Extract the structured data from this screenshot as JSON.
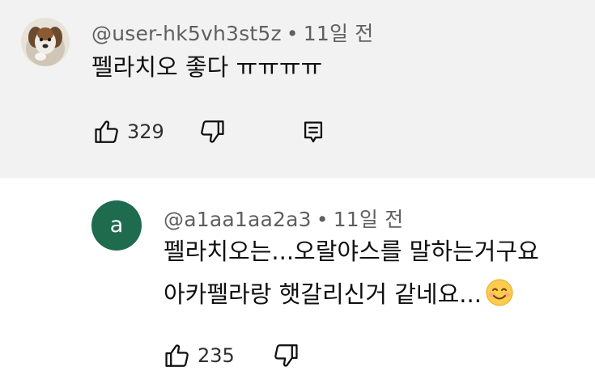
{
  "comment": {
    "author": "@user-hk5vh3st5z",
    "separator": "•",
    "time": "11일 전",
    "text": "펠라치오 좋다 ㅠㅠㅠㅠ",
    "like_count": "329"
  },
  "reply": {
    "avatar_letter": "a",
    "author": "@a1aa1aa2a3",
    "separator": "•",
    "time": "11일 전",
    "line1": "펠라치오는...오랄야스를 말하는거구요",
    "line2": "아카펠라랑 햇갈리신거 같네요...",
    "like_count": "235"
  },
  "colors": {
    "top_background": "#f2f2f2",
    "avatar_green": "#1e6b4d",
    "meta_gray": "#606060"
  },
  "icons": {
    "like": "thumbs-up-icon",
    "dislike": "thumbs-down-icon",
    "reply": "reply-comment-icon",
    "emoji": "smiling-face-emoji"
  }
}
